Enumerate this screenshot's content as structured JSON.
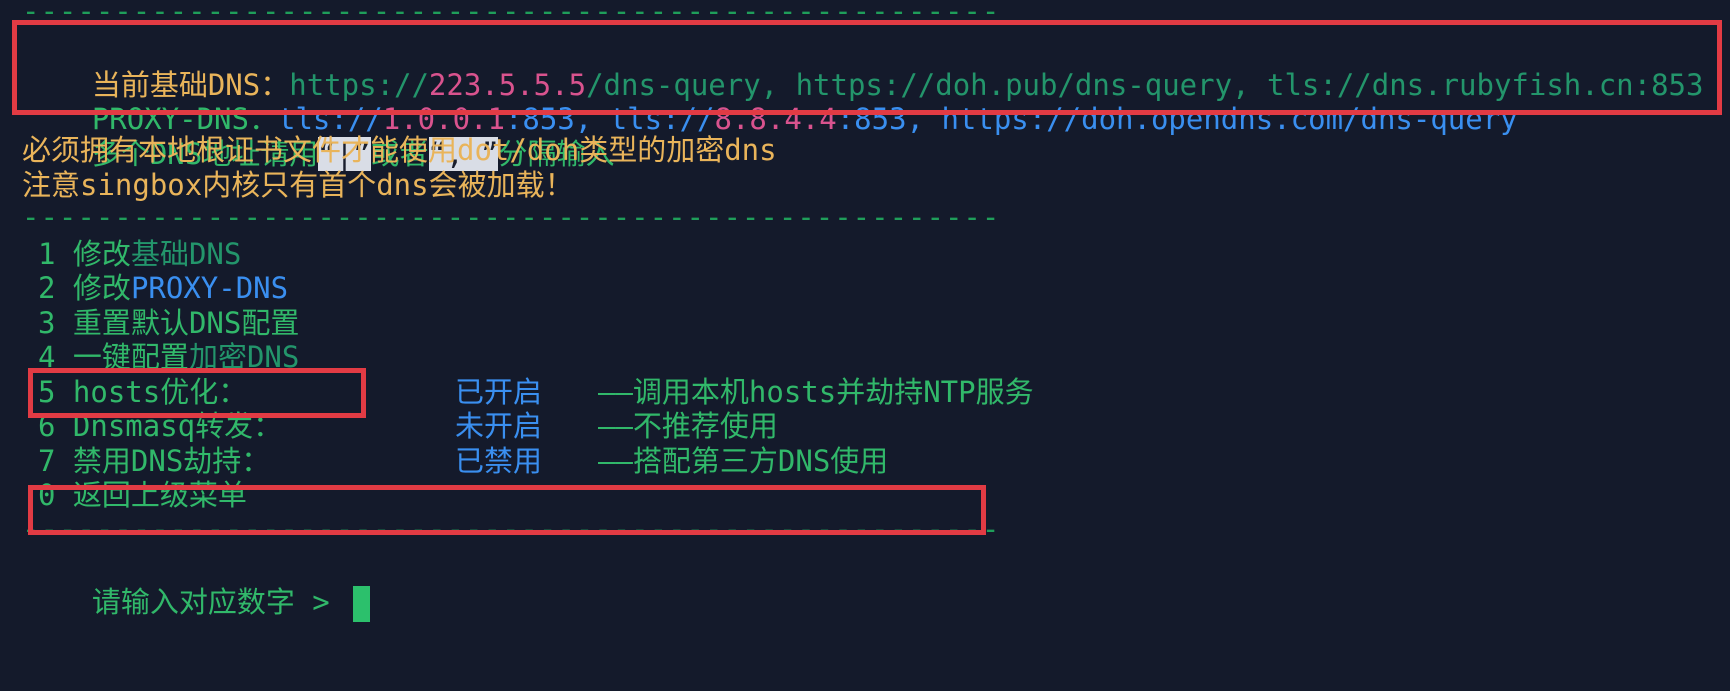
{
  "separator": "-----------------------------------------------------",
  "current_dns": {
    "label": "当前基础DNS：",
    "parts": [
      {
        "text": "https://",
        "color": "dg"
      },
      {
        "text": "223.5.5.5",
        "color": "p"
      },
      {
        "text": "/dns-query, https://doh.pub/dns-query, tls://dns.rubyfish.cn:853",
        "color": "dg"
      }
    ]
  },
  "proxy_dns": {
    "label": "PROXY-DNS：",
    "parts": [
      {
        "text": "tls://",
        "color": "b"
      },
      {
        "text": "1.0.0.1",
        "color": "p"
      },
      {
        "text": ":853, tls://",
        "color": "b"
      },
      {
        "text": "8.8.4.4",
        "color": "p"
      },
      {
        "text": ":853, https://doh.opendns.com/dns-query",
        "color": "b"
      }
    ]
  },
  "notes": {
    "line1_a": "多个DNS地址请用",
    "line1_hl1": "“|”",
    "line1_b": "或者",
    "line1_hl2": "“, ”",
    "line1_c": "分隔输入",
    "line2": "必须拥有本地根证书文件才能使用dot/doh类型的加密dns",
    "line3": "注意singbox内核只有首个dns会被加载！"
  },
  "menu": [
    {
      "num": "1",
      "prefix": "修改",
      "rest": "基础DNS",
      "rest_color": "dg",
      "status": "",
      "desc": ""
    },
    {
      "num": "2",
      "prefix": "修改",
      "rest": "PROXY-DNS",
      "rest_color": "b",
      "status": "",
      "desc": ""
    },
    {
      "num": "3",
      "prefix": "重置",
      "rest": "默认DNS配置",
      "rest_color": "g",
      "status": "",
      "desc": ""
    },
    {
      "num": "4",
      "prefix": "一键配置",
      "rest": "加密DNS",
      "rest_color": "dg",
      "status": "",
      "desc": ""
    },
    {
      "num": "5",
      "prefix": "hosts优化：",
      "rest": "",
      "rest_color": "g",
      "status": "已开启",
      "desc": "——调用本机hosts并劫持NTP服务"
    },
    {
      "num": "6",
      "prefix": "Dnsmasq转发：",
      "rest": "",
      "rest_color": "g",
      "status": "未开启",
      "desc": "——不推荐使用"
    },
    {
      "num": "7",
      "prefix": "禁用DNS劫持：",
      "rest": "",
      "rest_color": "g",
      "status": "已禁用",
      "desc": "——搭配第三方DNS使用"
    },
    {
      "num": "0",
      "prefix": "返回上级菜单",
      "rest": "",
      "rest_color": "g",
      "status": "",
      "desc": ""
    }
  ],
  "prompt": "请输入对应数字 > ",
  "colors": {
    "background": "#141a2b",
    "green": "#31b86a",
    "yellow": "#e9b45a",
    "blue": "#3a8ff0",
    "pink": "#d9538e",
    "highlight_box": "#e23b44"
  }
}
